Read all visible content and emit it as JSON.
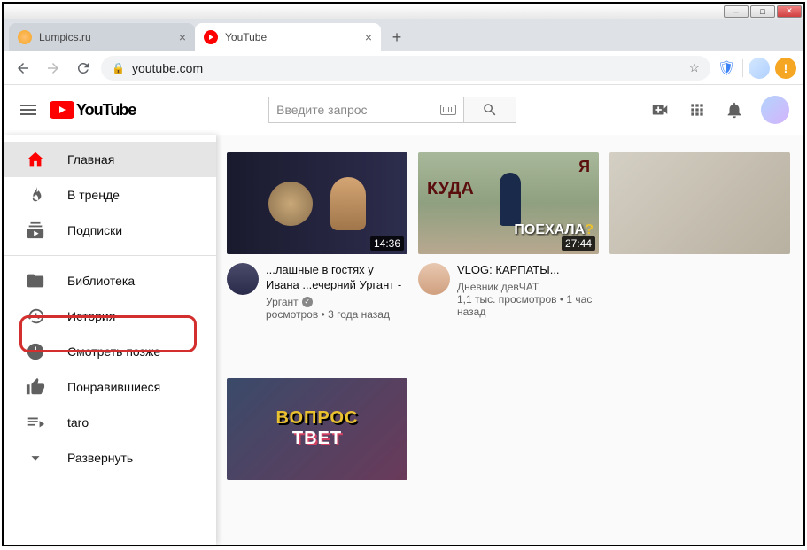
{
  "window": {
    "buttons": {
      "min": "–",
      "max": "□",
      "close": "✕"
    }
  },
  "tabs": [
    {
      "title": "Lumpics.ru",
      "favicon_color": "#f5a623"
    },
    {
      "title": "YouTube",
      "favicon_color": "#ff0000"
    }
  ],
  "new_tab_glyph": "+",
  "addressbar": {
    "url": "youtube.com",
    "back": "←",
    "forward": "→",
    "reload": "↻",
    "lock": "🔒",
    "star": "☆"
  },
  "extensions": [
    {
      "name": "shield",
      "color": "#3b82f6",
      "glyph": "🛡"
    },
    {
      "name": "divider",
      "color": "#ddd",
      "glyph": ""
    },
    {
      "name": "profile",
      "color": "#d4e8ff",
      "glyph": ""
    },
    {
      "name": "warn",
      "color": "#f5a623",
      "glyph": "!"
    }
  ],
  "yt_header": {
    "logo_text": "YouTube",
    "search_placeholder": "Введите запрос",
    "icons": {
      "create": "⧉",
      "apps": "⠿",
      "notif": "🔔"
    }
  },
  "sidebar": {
    "items": [
      {
        "label": "Главная",
        "icon": "home",
        "active": true
      },
      {
        "label": "В тренде",
        "icon": "fire"
      },
      {
        "label": "Подписки",
        "icon": "subs"
      }
    ],
    "items2": [
      {
        "label": "Библиотека",
        "icon": "folder"
      },
      {
        "label": "История",
        "icon": "history",
        "highlight": true
      },
      {
        "label": "Смотреть позже",
        "icon": "clock"
      },
      {
        "label": "Понравившиеся",
        "icon": "like"
      },
      {
        "label": "taro",
        "icon": "playlist"
      },
      {
        "label": "Развернуть",
        "icon": "expand"
      }
    ]
  },
  "videos": [
    {
      "title": "...лашные в гостях у Ивана ...ечерний Ургант -",
      "channel": "Ургант",
      "verified": true,
      "stats": "росмотров • 3 года назад",
      "duration": "14:36",
      "thumb_overlay": {}
    },
    {
      "title": "VLOG: КАРПАТЫ...",
      "channel": "Дневник девЧАТ",
      "verified": false,
      "stats": "1,1 тыс. просмотров • 1 час назад",
      "duration": "27:44",
      "thumb_overlay": {
        "t1": "Я",
        "t2": "КУДА",
        "t3w": "ПОЕХАЛА",
        "t3q": "?"
      }
    },
    {
      "title": "",
      "channel": "",
      "stats": "",
      "duration": "",
      "thumb_overlay": {}
    },
    {
      "title": "",
      "channel": "",
      "stats": "",
      "duration": "",
      "thumb_overlay": {
        "b1": "ВОПРОС",
        "b2": "TBET"
      }
    }
  ]
}
